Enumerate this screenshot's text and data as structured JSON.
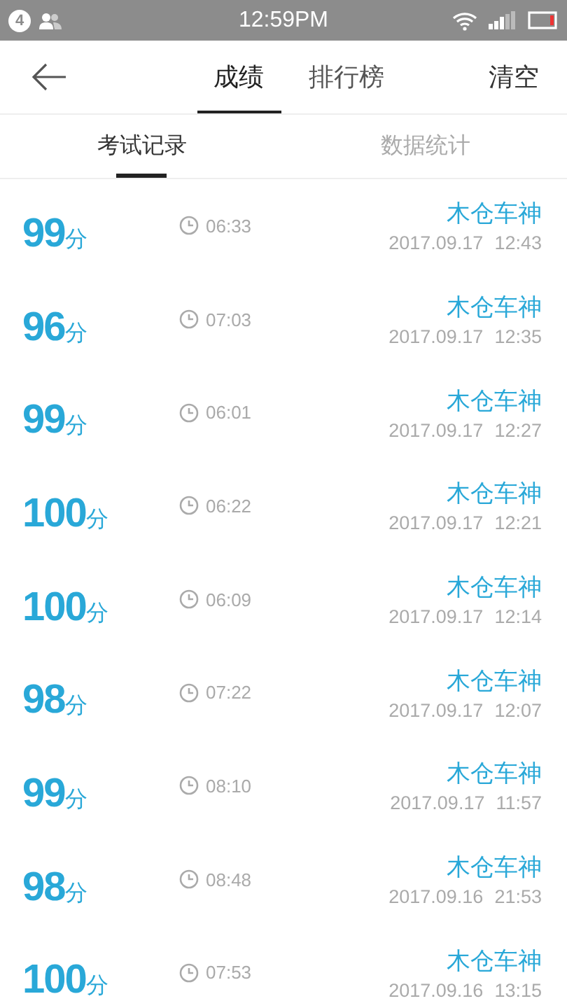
{
  "status_bar": {
    "notification_count": "4",
    "time": "12:59PM"
  },
  "header": {
    "tabs": [
      {
        "label": "成绩",
        "selected": true
      },
      {
        "label": "排行榜",
        "selected": false
      }
    ],
    "action": "清空"
  },
  "sub_tabs": [
    {
      "label": "考试记录",
      "selected": true
    },
    {
      "label": "数据统计",
      "selected": false
    }
  ],
  "records": [
    {
      "score": "99",
      "unit": "分",
      "duration": "06:33",
      "name": "木仓车神",
      "date": "2017.09.17",
      "time": "12:43"
    },
    {
      "score": "96",
      "unit": "分",
      "duration": "07:03",
      "name": "木仓车神",
      "date": "2017.09.17",
      "time": "12:35"
    },
    {
      "score": "99",
      "unit": "分",
      "duration": "06:01",
      "name": "木仓车神",
      "date": "2017.09.17",
      "time": "12:27"
    },
    {
      "score": "100",
      "unit": "分",
      "duration": "06:22",
      "name": "木仓车神",
      "date": "2017.09.17",
      "time": "12:21"
    },
    {
      "score": "100",
      "unit": "分",
      "duration": "06:09",
      "name": "木仓车神",
      "date": "2017.09.17",
      "time": "12:14"
    },
    {
      "score": "98",
      "unit": "分",
      "duration": "07:22",
      "name": "木仓车神",
      "date": "2017.09.17",
      "time": "12:07"
    },
    {
      "score": "99",
      "unit": "分",
      "duration": "08:10",
      "name": "木仓车神",
      "date": "2017.09.17",
      "time": "11:57"
    },
    {
      "score": "98",
      "unit": "分",
      "duration": "08:48",
      "name": "木仓车神",
      "date": "2017.09.16",
      "time": "21:53"
    },
    {
      "score": "100",
      "unit": "分",
      "duration": "07:53",
      "name": "木仓车神",
      "date": "2017.09.16",
      "time": "13:15"
    }
  ]
}
